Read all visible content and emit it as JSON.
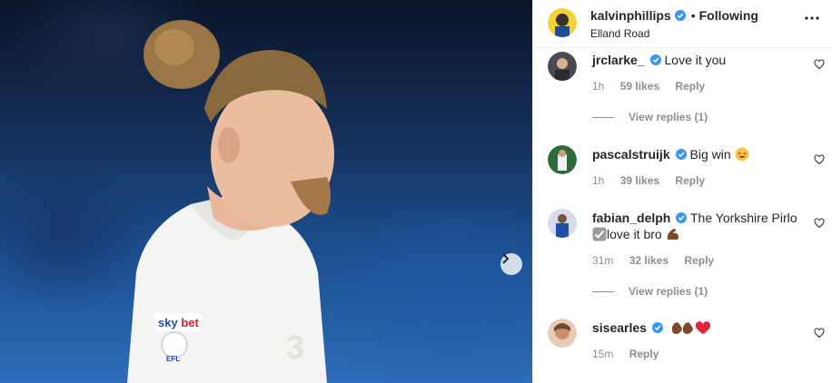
{
  "post": {
    "image_alt": "Kalvin Phillips in Leeds United shirt",
    "kit_brand": "sky bet",
    "badge_text": "EFL",
    "carousel_next_icon": "chevron-right-icon"
  },
  "header": {
    "username": "kalvinphillips",
    "separator": "•",
    "follow_status": "Following",
    "location": "Elland Road",
    "more_icon": "ellipsis-icon"
  },
  "comments": [
    {
      "username": "jrclarke_",
      "verified": true,
      "text": "Love it you",
      "time": "1h",
      "likes": "59 likes",
      "reply_label": "Reply",
      "view_replies": "View replies (1)"
    },
    {
      "username": "pascalstruijk",
      "verified": true,
      "text": "Big win",
      "emoji": "star-struck-emoji",
      "time": "1h",
      "likes": "39 likes",
      "reply_label": "Reply"
    },
    {
      "username": "fabian_delph",
      "verified": true,
      "text": "The Yorkshire Pirlo",
      "text2": "love it bro",
      "emoji": "check-mark-emoji",
      "emoji2": "flexed-biceps-emoji",
      "time": "31m",
      "likes": "32 likes",
      "reply_label": "Reply",
      "view_replies": "View replies (1)"
    },
    {
      "username": "sisearles",
      "verified": true,
      "text": "",
      "emoji": "clap-clap-heart-emoji",
      "time": "15m",
      "reply_label": "Reply"
    }
  ],
  "colors": {
    "verified_blue": "#3897f0",
    "meta_gray": "#8e8e8e",
    "text": "#262626"
  }
}
